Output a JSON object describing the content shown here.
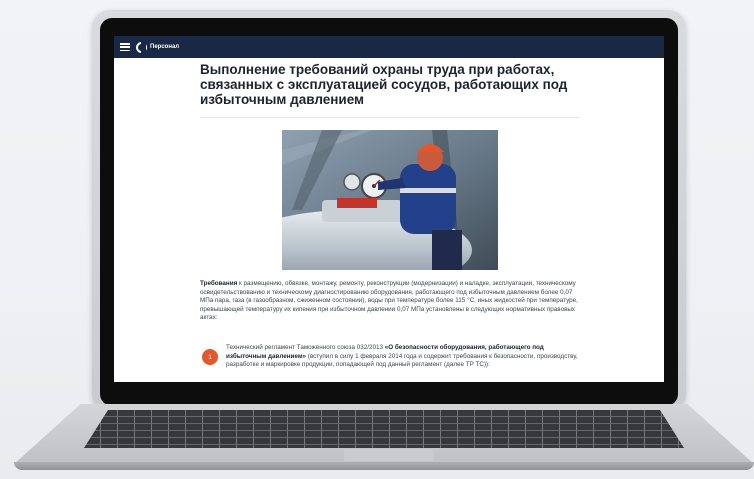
{
  "header": {
    "menu_icon": "menu-icon",
    "logo_small_text": "",
    "logo_title": "Персонал",
    "background_color": "#182845"
  },
  "article": {
    "title": "Выполнение требований охраны труда при работах, связанных с эксплуатацией сосудов, работающих под избыточным давлением",
    "photo_description_icon": "worker-photo",
    "intro_bold": "Требования",
    "intro_text": " к размещению, обвязке, монтажу, ремонту, реконструкции (модернизации) и наладке, эксплуатации, техническому освидетельствованию и техническому диагностированию оборудования, работающего под избыточным давлением более 0,07 МПа пара, газа (в газообразном, сжиженном состоянии), воды при температуре более 115 °С, иных жидкостей при температуре, превышающей температуру их кипения при избыточном давлении 0,07 МПа установлены в следующих нормативных правовых актах:",
    "list": [
      {
        "number": "1",
        "prefix": "Технический регламент Таможенного союза 032/2013 ",
        "bold": "«О безопасности оборудования, работающего под избыточным давлением»",
        "suffix": " (вступил в силу 1 февраля 2014 года и содержит требования к безопасности, производству, разработке и маркировке продукции, попадающей под данный регламент (далее ТР ТС)):"
      }
    ],
    "accent_color": "#e2572b"
  }
}
